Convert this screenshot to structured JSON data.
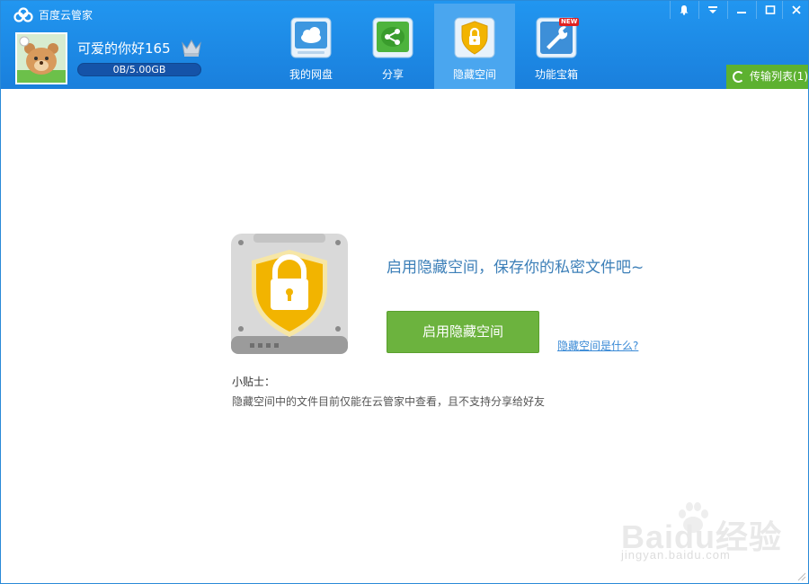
{
  "app": {
    "title": "百度云管家"
  },
  "user": {
    "name": "可爱的你好165",
    "quota_text": "0B/5.00GB",
    "quota_used_fraction": 0
  },
  "nav": {
    "items": [
      {
        "label": "我的网盘",
        "icon": "cloud-drive-icon",
        "active": false
      },
      {
        "label": "分享",
        "icon": "share-icon",
        "active": false
      },
      {
        "label": "隐藏空间",
        "icon": "hidden-space-lock-icon",
        "active": true
      },
      {
        "label": "功能宝箱",
        "icon": "toolbox-wrench-icon",
        "active": false,
        "badge": "NEW"
      }
    ]
  },
  "window_controls": [
    "notification-bell-icon",
    "menu-dropdown-icon",
    "minimize-icon",
    "maximize-icon",
    "close-icon"
  ],
  "transfer": {
    "label": "传输列表(1)"
  },
  "content": {
    "headline": "启用隐藏空间，保存你的私密文件吧~",
    "enable_button": "启用隐藏空间",
    "what_link": "隐藏空间是什么?",
    "tips_title": "小贴士：",
    "tips_text": "隐藏空间中的文件目前仅能在云管家中查看，且不支持分享给好友"
  },
  "watermark": {
    "main": "Baidu经验",
    "url": "jingyan.baidu.com"
  },
  "colors": {
    "header_blue": "#1e88e5",
    "active_tab": "#4aa6ef",
    "green": "#6cb33e",
    "link_blue": "#3a8ad6",
    "shield_yellow": "#f2b400"
  }
}
